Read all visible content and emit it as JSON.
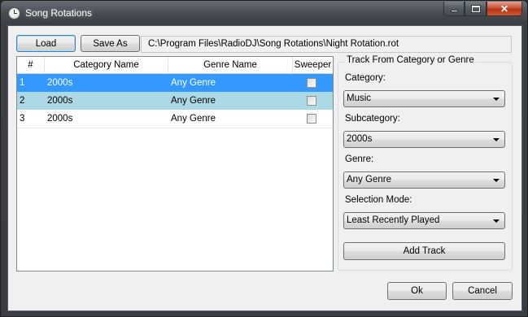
{
  "window": {
    "title": "Song Rotations"
  },
  "toolbar": {
    "load_label": "Load",
    "save_as_label": "Save As",
    "file_path": "C:\\Program Files\\RadioDJ\\Song Rotations\\Night Rotation.rot"
  },
  "grid": {
    "headers": {
      "num": "#",
      "category": "Category Name",
      "genre": "Genre Name",
      "sweeper": "Sweeper"
    },
    "rows": [
      {
        "num": "1",
        "category": "2000s",
        "genre": "Any Genre",
        "sweeper": false
      },
      {
        "num": "2",
        "category": "2000s",
        "genre": "Any Genre",
        "sweeper": false
      },
      {
        "num": "3",
        "category": "2000s",
        "genre": "Any Genre",
        "sweeper": false
      }
    ]
  },
  "track_panel": {
    "title": "Track From Category or Genre",
    "category_label": "Category:",
    "category_value": "Music",
    "subcategory_label": "Subcategory:",
    "subcategory_value": "2000s",
    "genre_label": "Genre:",
    "genre_value": "Any Genre",
    "selection_mode_label": "Selection Mode:",
    "selection_mode_value": "Least Recently Played",
    "add_track_label": "Add Track"
  },
  "footer": {
    "ok_label": "Ok",
    "cancel_label": "Cancel"
  },
  "colors": {
    "selected_row": "#3399ff",
    "highlight_row": "#add8e6",
    "close_button": "#c9533a"
  },
  "icons": [
    "clock-icon",
    "minimize-icon",
    "maximize-icon",
    "close-icon",
    "chevron-down-icon"
  ]
}
